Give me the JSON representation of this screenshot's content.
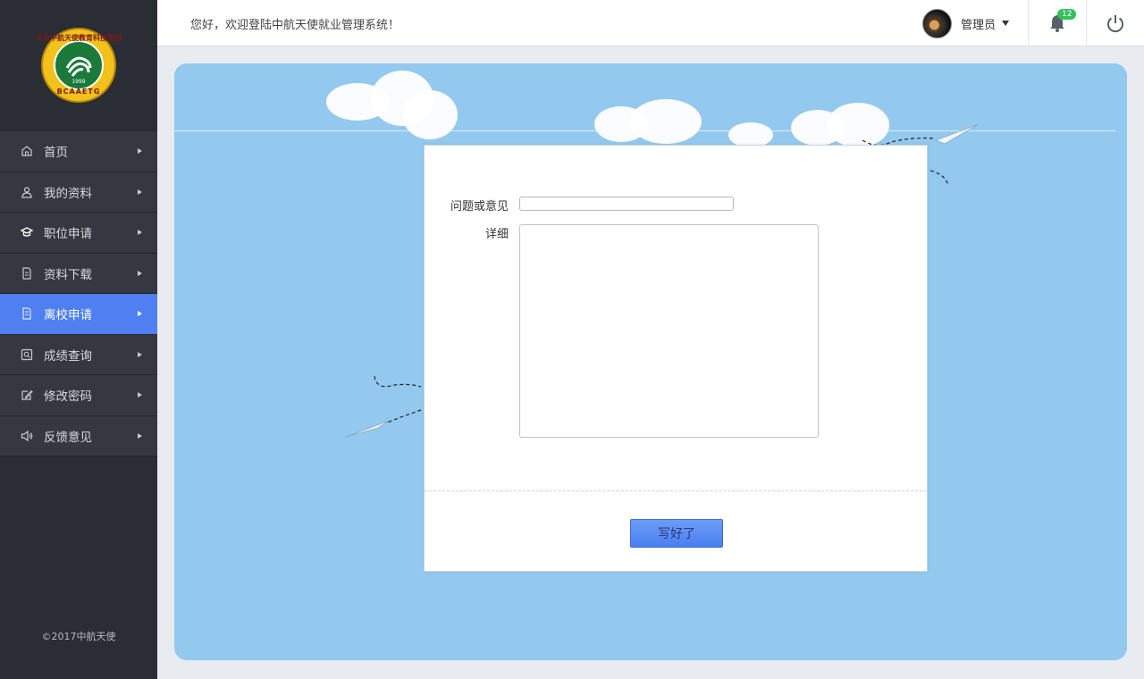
{
  "logo": {
    "ring_text": "北京中航天使教育科技集团",
    "bottom_text": "BCAAETG",
    "year": "1999"
  },
  "sidebar": {
    "items": [
      {
        "label": "首页",
        "icon": "home-icon",
        "active": false
      },
      {
        "label": "我的资料",
        "icon": "user-icon",
        "active": false
      },
      {
        "label": "职位申请",
        "icon": "graduation-cap-icon",
        "active": false
      },
      {
        "label": "资料下载",
        "icon": "document-icon",
        "active": false
      },
      {
        "label": "离校申请",
        "icon": "file-icon",
        "active": true
      },
      {
        "label": "成绩查询",
        "icon": "search-doc-icon",
        "active": false
      },
      {
        "label": "修改密码",
        "icon": "edit-icon",
        "active": false
      },
      {
        "label": "反馈意见",
        "icon": "speaker-icon",
        "active": false
      }
    ],
    "copyright": "©2017中航天使"
  },
  "header": {
    "welcome": "您好，欢迎登陆中航天使就业管理系统！",
    "username": "管理员",
    "notification_count": "12"
  },
  "form": {
    "question_label": "问题或意见",
    "question_value": "",
    "detail_label": "详细",
    "detail_value": "",
    "submit_label": "写好了"
  },
  "colors": {
    "sidebar_bg": "#363841",
    "active_bg": "#4f7ff0",
    "panel_bg": "#93c9ee",
    "badge": "#2fc25b"
  }
}
